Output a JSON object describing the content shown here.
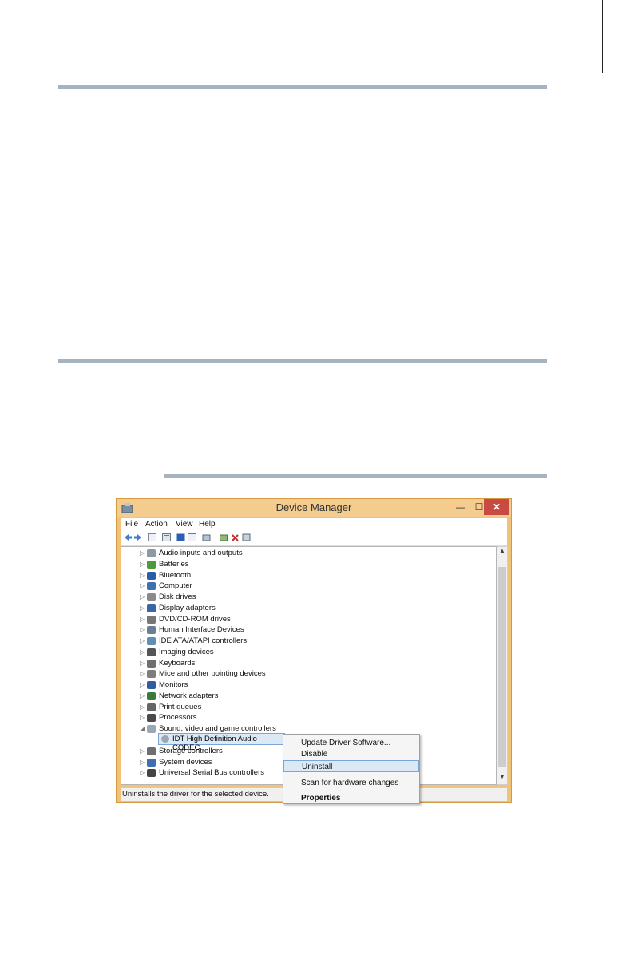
{
  "window": {
    "title": "Device Manager",
    "min_glyph": "—",
    "max_glyph": "☐",
    "close_glyph": "✕"
  },
  "menu": [
    {
      "label": "File"
    },
    {
      "label": "Action"
    },
    {
      "label": "View"
    },
    {
      "label": "Help"
    }
  ],
  "tree": [
    {
      "label": "Audio inputs and outputs",
      "icon": "speaker-icon",
      "color": "#8a9aa6"
    },
    {
      "label": "Batteries",
      "icon": "battery-icon",
      "color": "#4c9a3a"
    },
    {
      "label": "Bluetooth",
      "icon": "bluetooth-icon",
      "color": "#2a5aa8"
    },
    {
      "label": "Computer",
      "icon": "computer-icon",
      "color": "#3f6fb0"
    },
    {
      "label": "Disk drives",
      "icon": "disk-drive-icon",
      "color": "#8a8a8a"
    },
    {
      "label": "Display adapters",
      "icon": "display-adapter-icon",
      "color": "#3b66a5"
    },
    {
      "label": "DVD/CD-ROM drives",
      "icon": "dvd-drive-icon",
      "color": "#777777"
    },
    {
      "label": "Human Interface Devices",
      "icon": "hid-icon",
      "color": "#6a7f92"
    },
    {
      "label": "IDE ATA/ATAPI controllers",
      "icon": "ide-controller-icon",
      "color": "#5f8fb5"
    },
    {
      "label": "Imaging devices",
      "icon": "camera-icon",
      "color": "#555555"
    },
    {
      "label": "Keyboards",
      "icon": "keyboard-icon",
      "color": "#707070"
    },
    {
      "label": "Mice and other pointing devices",
      "icon": "mouse-icon",
      "color": "#7d7d7d"
    },
    {
      "label": "Monitors",
      "icon": "monitor-icon",
      "color": "#2f5ea0"
    },
    {
      "label": "Network adapters",
      "icon": "network-adapter-icon",
      "color": "#3a7a3a"
    },
    {
      "label": "Print queues",
      "icon": "printer-icon",
      "color": "#666666"
    },
    {
      "label": "Processors",
      "icon": "processor-icon",
      "color": "#4a4a4a"
    },
    {
      "label": "Sound, video and game controllers",
      "icon": "sound-icon",
      "color": "#9aa8b4",
      "expanded": true
    },
    {
      "label": "Storage controllers",
      "icon": "storage-controller-icon",
      "color": "#6f6f6f"
    },
    {
      "label": "System devices",
      "icon": "system-device-icon",
      "color": "#3f6fb0"
    },
    {
      "label": "Universal Serial Bus controllers",
      "icon": "usb-icon",
      "color": "#444444"
    }
  ],
  "selected_child": {
    "label": "IDT High Definition Audio CODEC"
  },
  "context_menu": [
    {
      "label": "Update Driver Software..."
    },
    {
      "label": "Disable"
    },
    {
      "label": "Uninstall",
      "highlighted": true
    },
    {
      "label": "Scan for hardware changes"
    },
    {
      "label": "Properties",
      "bold": true
    }
  ],
  "status_text": "Uninstalls the driver for the selected device."
}
